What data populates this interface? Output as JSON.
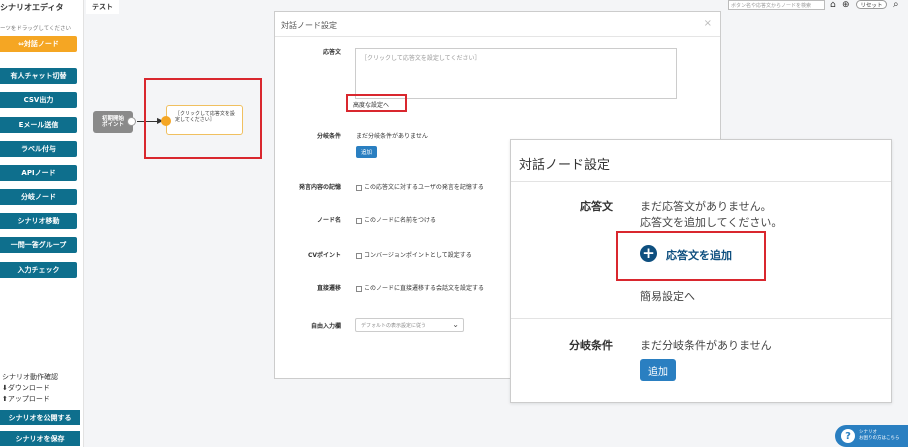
{
  "sidebar": {
    "title": "シナリオエディタ",
    "hint": "ーツをドラッグしてください",
    "nodes": [
      "⇔対話ノード",
      "有人チャット切替",
      "CSV出力",
      "Eメール送信",
      "ラベル付与",
      "APIノード",
      "分岐ノード",
      "シナリオ移動",
      "一問一答グループ",
      "入力チェック"
    ],
    "verify_label": "シナリオ動作確認",
    "download_label": "ダウンロード",
    "upload_label": "アップロード",
    "publish_button": "シナリオを公開する",
    "save_button": "シナリオを保存"
  },
  "topbar": {
    "tab": "テスト",
    "search_placeholder": "ボタン名や応答文からノードを検索",
    "reset_label": "リセット"
  },
  "canvas": {
    "start_node": "初期開始\nポイント",
    "dialog_node": "［クリックして応答文を設\n定してください］"
  },
  "panel1": {
    "title": "対話ノード設定",
    "response_label": "応答文",
    "textarea_placeholder": "［クリックして応答文を設定してください］",
    "advanced_link": "高度な設定へ",
    "branch_label": "分岐条件",
    "branch_text": "まだ分岐条件がありません",
    "add_button": "追加",
    "record_label": "発言内容の記憶",
    "record_option": "この応答文に対するユーザの発言を記憶する",
    "name_label": "ノード名",
    "name_option": "このノードに名前をつける",
    "cv_label": "CVポイント",
    "cv_option": "コンバージョンポイントとして設定する",
    "direct_label": "直接遷移",
    "direct_option": "このノードに直接遷移する会話文を設定する",
    "free_input_label": "自由入力欄",
    "free_input_value": "デフォルトの表示設定に従う"
  },
  "panel2": {
    "title": "対話ノード設定",
    "response_label": "応答文",
    "response_line1": "まだ応答文がありません。",
    "response_line2": "応答文を追加してください。",
    "add_response": "応答文を追加",
    "simple_settings": "簡易設定へ",
    "branch_label": "分岐条件",
    "branch_text": "まだ分岐条件がありません",
    "add_button": "追加"
  },
  "help": {
    "line1": "シナリオ",
    "line2": "お困りの方はこちら"
  },
  "colors": {
    "primary": "#0e6f8d",
    "accent": "#f5a623",
    "highlight": "#d9272e",
    "button_blue": "#2a7fc1"
  }
}
